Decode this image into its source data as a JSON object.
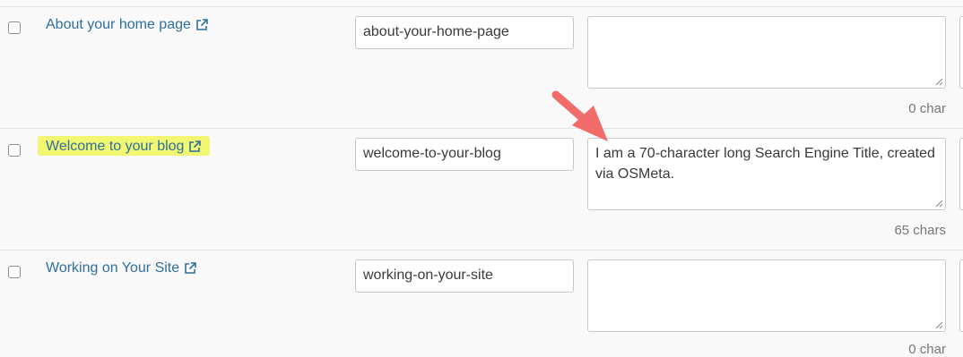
{
  "rows": [
    {
      "title": "About your home page",
      "slug": "about-your-home-page",
      "seo_title": "",
      "char_count": "0 char",
      "highlighted": false
    },
    {
      "title": "Welcome to your blog",
      "slug": "welcome-to-your-blog",
      "seo_title": "I am a 70-character long Search Engine Title, created via OSMeta.",
      "char_count": "65 chars",
      "highlighted": true
    },
    {
      "title": "Working on Your Site",
      "slug": "working-on-your-site",
      "seo_title": "",
      "char_count": "0 char",
      "highlighted": false
    }
  ],
  "colors": {
    "link": "#2f6f9e",
    "highlight": "#f1f771",
    "annotation_arrow": "#f26b6b"
  },
  "icons": {
    "external_link": "external-link-icon",
    "annotation": "red-arrow-annotation"
  }
}
